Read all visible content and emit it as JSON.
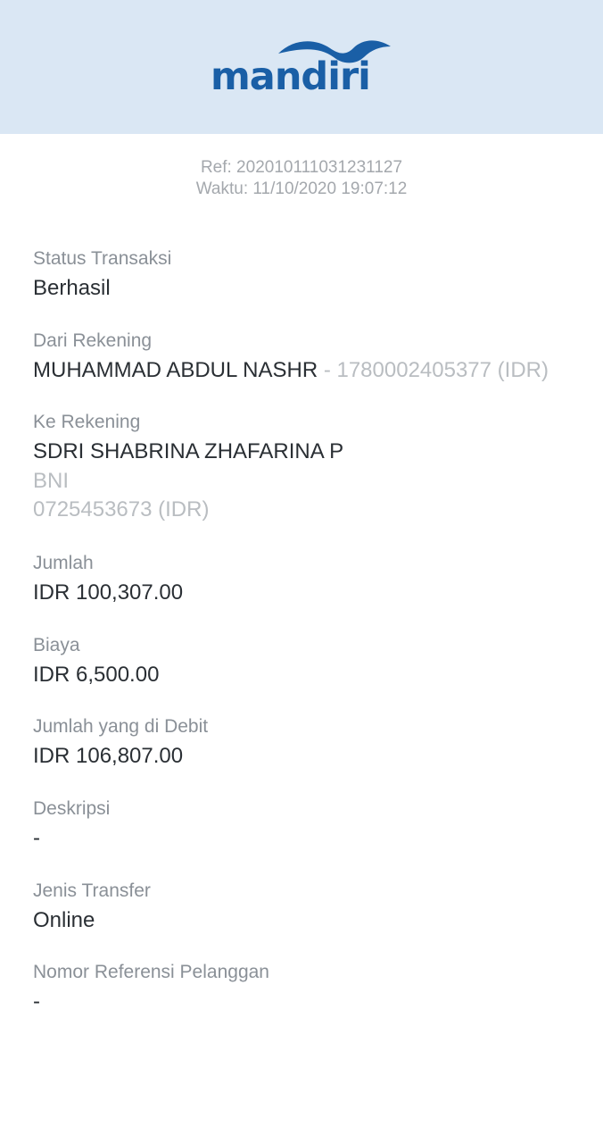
{
  "header": {
    "brand": "mandiri",
    "brand_color": "#1a5fa6",
    "background": "#dae7f4",
    "logo_icon": "mandiri-wave-logo"
  },
  "receipt": {
    "ref": "Ref: 202010111031231127",
    "time": "Waktu: 11/10/2020 19:07:12"
  },
  "fields": {
    "status": {
      "label": "Status Transaksi",
      "value": "Berhasil"
    },
    "from": {
      "label": "Dari Rekening",
      "name": "MUHAMMAD ABDUL NASHR",
      "detail": " - 1780002405377 (IDR)"
    },
    "to": {
      "label": "Ke Rekening",
      "name": "SDRI SHABRINA ZHAFARINA P",
      "bank": "BNI",
      "account": "0725453673 (IDR)"
    },
    "amount": {
      "label": "Jumlah",
      "value": "IDR 100,307.00"
    },
    "fee": {
      "label": "Biaya",
      "value": "IDR 6,500.00"
    },
    "debited": {
      "label": "Jumlah yang di Debit",
      "value": "IDR 106,807.00"
    },
    "description": {
      "label": "Deskripsi",
      "value": "-"
    },
    "transfer_type": {
      "label": "Jenis Transfer",
      "value": "Online"
    },
    "customer_ref": {
      "label": "Nomor Referensi Pelanggan",
      "value": "-"
    }
  }
}
